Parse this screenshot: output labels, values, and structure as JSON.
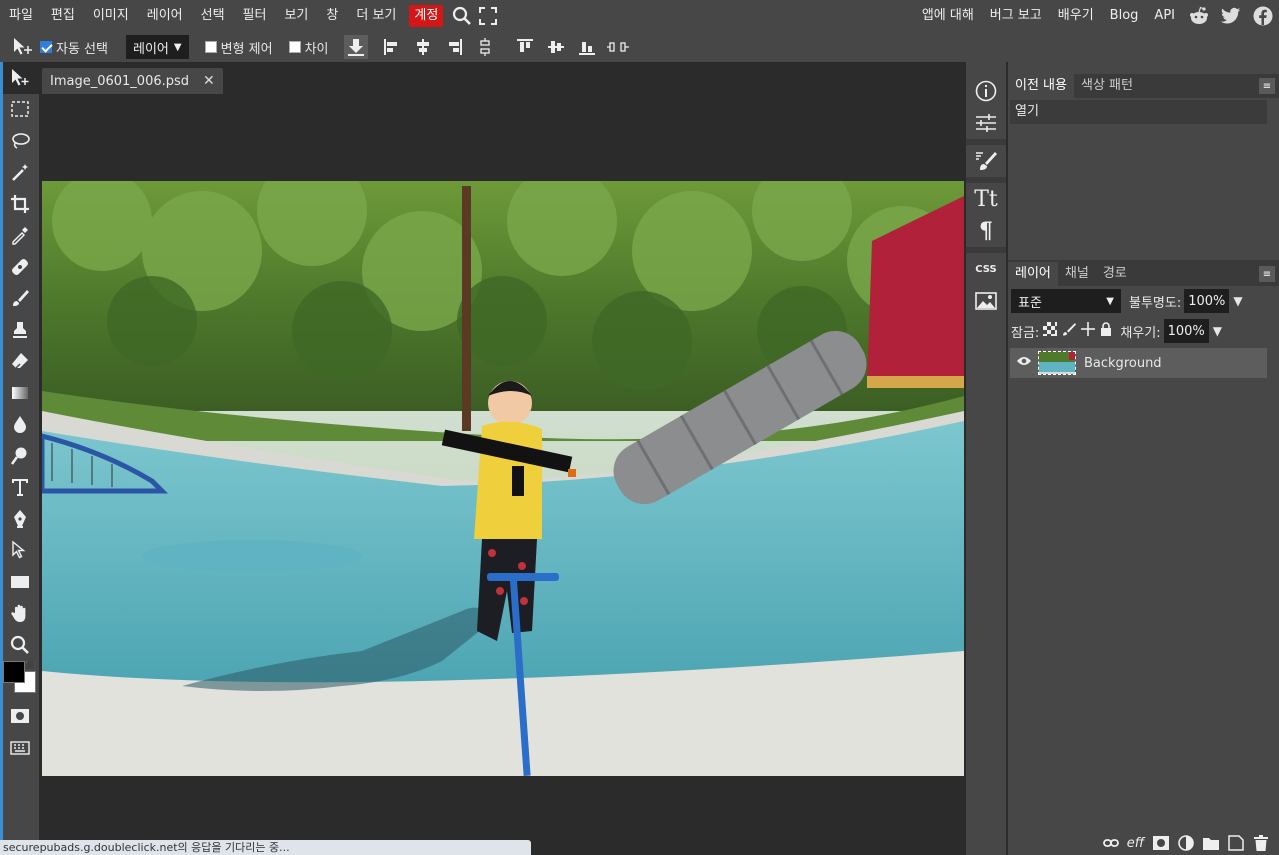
{
  "menubar": {
    "items": [
      "파일",
      "편집",
      "이미지",
      "레이어",
      "선택",
      "필터",
      "보기",
      "창",
      "더 보기"
    ],
    "account": "계정",
    "right_links": [
      "앱에 대해",
      "버그 보고",
      "배우기",
      "Blog",
      "API"
    ],
    "social_icons": [
      "reddit-icon",
      "twitter-icon",
      "facebook-icon"
    ],
    "accent_color": "#d41616"
  },
  "optionsbar": {
    "auto_select_label": "자동 선택",
    "auto_select_checked": true,
    "target_select": "레이어",
    "transform_label": "변형 제어",
    "transform_checked": false,
    "distance_label": "차이",
    "distance_checked": false
  },
  "tools": [
    "move-tool",
    "marquee-tool",
    "lasso-tool",
    "magic-wand-tool",
    "crop-tool",
    "eyedropper-tool",
    "healing-tool",
    "brush-tool",
    "stamp-tool",
    "eraser-tool",
    "gradient-tool",
    "blur-tool",
    "dodge-tool",
    "type-tool",
    "pen-tool",
    "path-select-tool",
    "shape-tool",
    "hand-tool",
    "zoom-tool"
  ],
  "colors": {
    "foreground": "#000000",
    "background": "#ffffff"
  },
  "document": {
    "tab_title": "Image_0601_006.psd",
    "close_glyph": "✕"
  },
  "midstrip": {
    "collapse_left": "<>",
    "collapse_right": "><",
    "css_label": "CSS"
  },
  "history_panel": {
    "tabs": [
      "이전 내용",
      "색상 패턴"
    ],
    "entries": [
      "열기"
    ]
  },
  "layers_panel": {
    "tabs": [
      "레이어",
      "채널",
      "경로"
    ],
    "blend_mode": "표준",
    "opacity_label": "불투명도:",
    "opacity_value": "100%",
    "lock_label": "잠금:",
    "fill_label": "채우기:",
    "fill_value": "100%",
    "layers": [
      {
        "name": "Background",
        "visible": true
      }
    ],
    "footer_icons": [
      "link-icon",
      "effects-icon",
      "mask-icon",
      "adjustment-icon",
      "folder-icon",
      "new-layer-icon",
      "trash-icon"
    ],
    "effects_text": "eff"
  },
  "status": {
    "text": "securepubads.g.doubleclick.net의 응답을 기다리는 중..."
  }
}
